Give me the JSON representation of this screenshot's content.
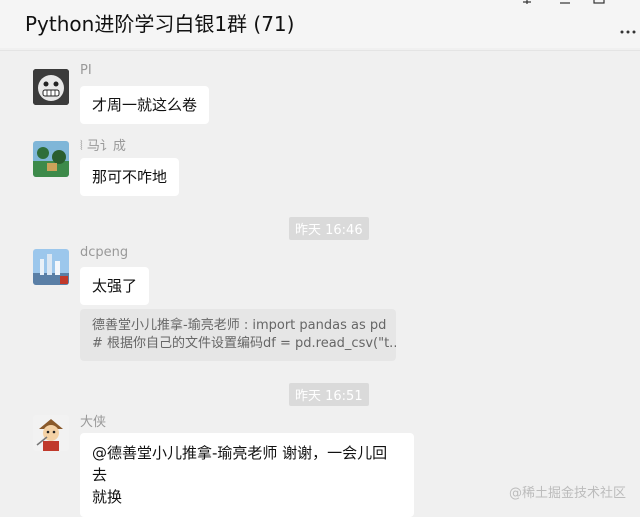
{
  "header": {
    "title": "Python进阶学习白银1群 (71)",
    "pin_icon": "pin-icon",
    "minimize_icon": "minimize-icon",
    "maximize_icon": "maximize-icon",
    "more_icon": "more-icon"
  },
  "messages": [
    {
      "sender": "PI",
      "text": "才周一就这么卷"
    },
    {
      "sender": "⦚ 马讠成",
      "text": "那可不咋地"
    },
    {
      "time": "昨天 16:46"
    },
    {
      "sender": "dcpeng",
      "text": "太强了",
      "quote_line1": "德善堂小儿推拿-瑜亮老师 : import pandas as pd",
      "quote_line2": "# 根据你自己的文件设置编码df = pd.read_csv(\"t..."
    },
    {
      "time": "昨天 16:51"
    },
    {
      "sender": "大侠",
      "text_line1": "@德善堂小儿推拿-瑜亮老师 谢谢，一会儿回去",
      "text_line2": "就换"
    }
  ],
  "watermark": "@稀土掘金技术社区",
  "colors": {
    "background": "#f0f0f0",
    "bubble": "#ffffff",
    "quote": "#e6e6e6",
    "time_badge": "#dadada"
  }
}
